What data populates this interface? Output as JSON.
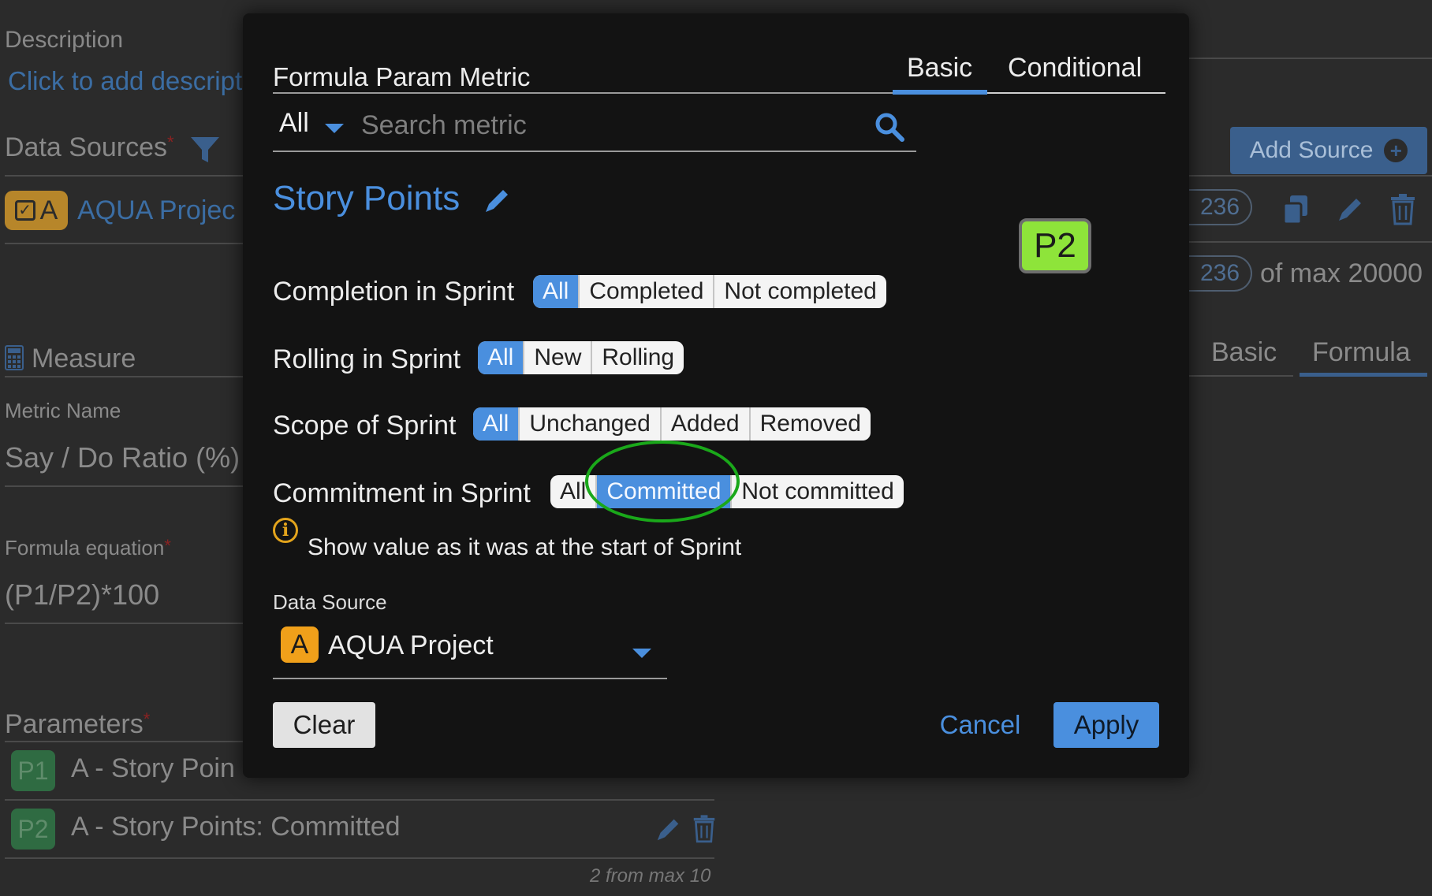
{
  "background": {
    "description_label": "Description",
    "description_link": "Click to add descripti",
    "data_sources_label": "Data Sources",
    "data_source_row": {
      "badge": "A",
      "name": "AQUA Projec",
      "count": "236"
    },
    "add_source_label": "Add Source",
    "count_pill_2": "236",
    "max_text": "of max 20000",
    "measure_label": "Measure",
    "metric_name_label": "Metric Name",
    "metric_name_value": "Say / Do Ratio (%)",
    "right_tabs": [
      "Basic",
      "Formula"
    ],
    "formula_label": "Formula equation",
    "formula_value": "(P1/P2)*100",
    "parameters_label": "Parameters",
    "parameters": [
      {
        "badge": "P1",
        "label": "A - Story Poin"
      },
      {
        "badge": "P2",
        "label": "A - Story Points: Committed"
      }
    ],
    "params_count": "2 from max 10"
  },
  "modal": {
    "title": "Formula Param Metric",
    "tabs": [
      "Basic",
      "Conditional"
    ],
    "active_tab": "Basic",
    "filter_value": "All",
    "search_placeholder": "Search metric",
    "metric_name": "Story Points",
    "param_badge": "P2",
    "rows": [
      {
        "label": "Completion in Sprint",
        "options": [
          "All",
          "Completed",
          "Not completed"
        ],
        "selected": "All"
      },
      {
        "label": "Rolling in Sprint",
        "options": [
          "All",
          "New",
          "Rolling"
        ],
        "selected": "All"
      },
      {
        "label": "Scope of Sprint",
        "options": [
          "All",
          "Unchanged",
          "Added",
          "Removed"
        ],
        "selected": "All"
      },
      {
        "label": "Commitment in Sprint",
        "options": [
          "All",
          "Committed",
          "Not committed"
        ],
        "selected": "Committed"
      }
    ],
    "info_text": "Show value as it was at the start of Sprint",
    "data_source_label": "Data Source",
    "data_source_badge": "A",
    "data_source_value": "AQUA Project",
    "clear_label": "Clear",
    "cancel_label": "Cancel",
    "apply_label": "Apply"
  },
  "colors": {
    "accent": "#4a8fde",
    "badge_p2": "#8ee43a",
    "data_source_badge": "#f0a01a",
    "info": "#e3a41c",
    "highlight_ring": "#1aa81a"
  },
  "icons": [
    "filter-icon",
    "plus-circle-icon",
    "copy-icon",
    "pencil-icon",
    "trash-icon",
    "calculator-icon",
    "search-icon",
    "caret-down-icon",
    "info-icon"
  ]
}
